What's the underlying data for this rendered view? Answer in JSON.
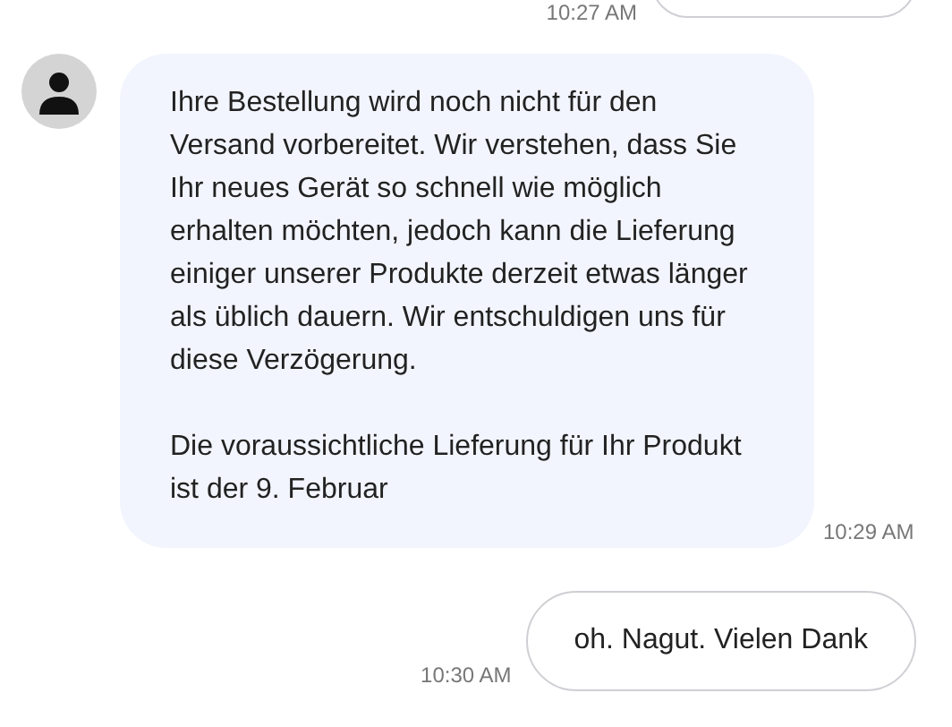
{
  "messages": [
    {
      "kind": "user",
      "time": "10:27 AM"
    },
    {
      "kind": "agent",
      "time": "10:29 AM",
      "paragraphs": [
        "Ihre Bestellung wird noch nicht für den Versand vorbereitet. Wir verstehen, dass Sie Ihr neues Gerät so schnell wie möglich erhalten möchten, jedoch kann die Lieferung einiger unserer Produkte derzeit etwas länger als üblich dauern. Wir entschuldigen uns für diese Verzögerung.",
        "Die voraussichtliche Lieferung für Ihr Produkt ist der 9. Februar"
      ]
    },
    {
      "kind": "user",
      "time": "10:30 AM",
      "paragraphs": [
        "oh. Nagut. Vielen Dank"
      ]
    }
  ]
}
